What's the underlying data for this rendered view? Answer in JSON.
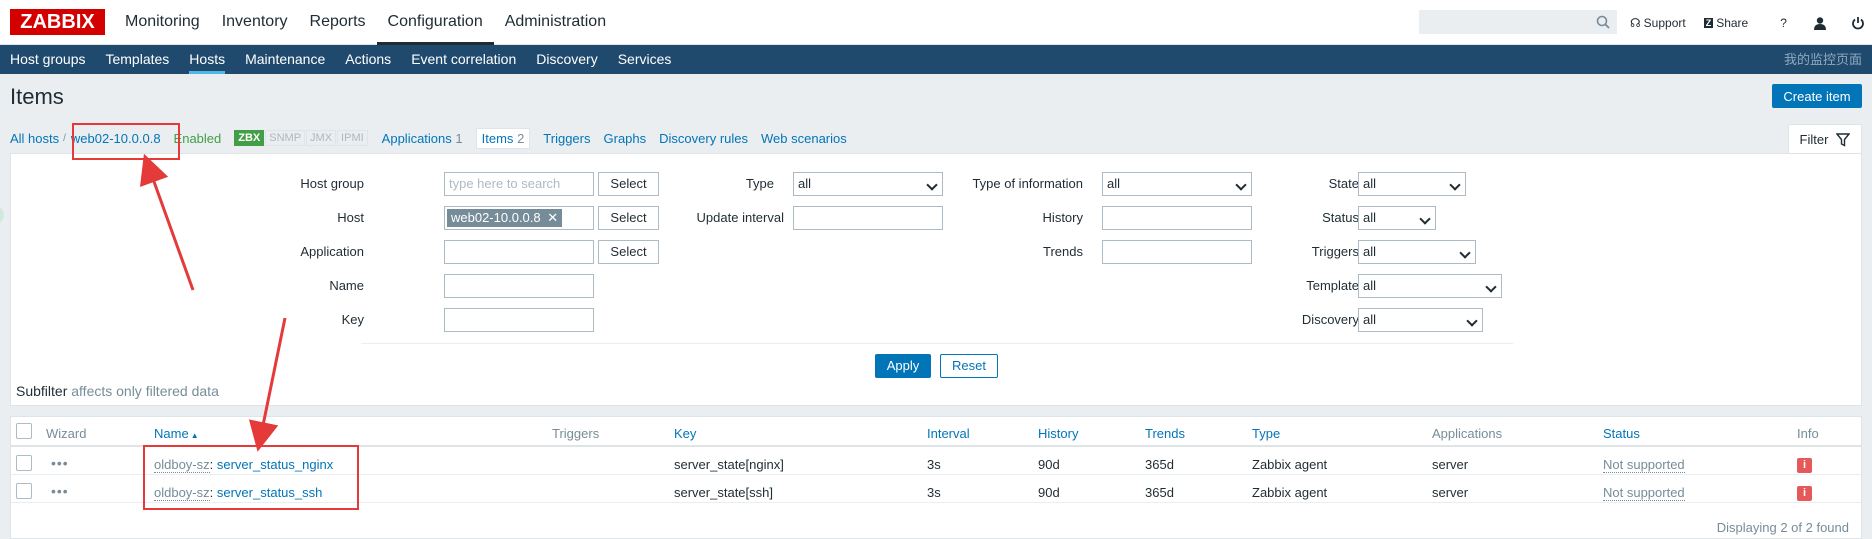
{
  "app": {
    "logo": "ZABBIX",
    "main_menu": [
      "Monitoring",
      "Inventory",
      "Reports",
      "Configuration",
      "Administration"
    ],
    "active_main": "Configuration",
    "search": {
      "placeholder": ""
    },
    "top_links": [
      {
        "icon": "headset-icon",
        "label": "Support"
      },
      {
        "icon": "share-icon",
        "label": "Share"
      },
      {
        "icon": "help-icon",
        "label": "?"
      },
      {
        "icon": "user-icon",
        "label": ""
      },
      {
        "icon": "power-icon",
        "label": ""
      }
    ]
  },
  "subnav": {
    "items": [
      "Host groups",
      "Templates",
      "Hosts",
      "Maintenance",
      "Actions",
      "Event correlation",
      "Discovery",
      "Services"
    ],
    "active": "Hosts",
    "right_text": "我的监控页面"
  },
  "page": {
    "title": "Items",
    "create_button": "Create item"
  },
  "host_nav": {
    "all_hosts": "All hosts",
    "separator": "/",
    "host": "web02-10.0.0.8",
    "status": "Enabled",
    "availability": [
      "ZBX",
      "SNMP",
      "JMX",
      "IPMI"
    ],
    "applications_label": "Applications",
    "applications_count": "1",
    "items_label": "Items",
    "items_count": "2",
    "triggers": "Triggers",
    "graphs": "Graphs",
    "discovery_rules": "Discovery rules",
    "web_scenarios": "Web scenarios",
    "filter_tab": "Filter"
  },
  "filter": {
    "host_group_label": "Host group",
    "host_group_placeholder": "type here to search",
    "host_label": "Host",
    "host_value": "web02-10.0.0.8",
    "application_label": "Application",
    "name_label": "Name",
    "key_label": "Key",
    "select_label": "Select",
    "type_label": "Type",
    "type_value": "all",
    "update_interval_label": "Update interval",
    "type_of_information_label": "Type of information",
    "type_of_information_value": "all",
    "history_label": "History",
    "trends_label": "Trends",
    "state_label": "State",
    "state_value": "all",
    "status_label": "Status",
    "status_value": "all",
    "triggers_label": "Triggers",
    "triggers_value": "all",
    "template_label": "Template",
    "template_value": "all",
    "discovery_label": "Discovery",
    "discovery_value": "all",
    "apply": "Apply",
    "reset": "Reset"
  },
  "subfilter": {
    "label": "Subfilter",
    "note": "affects only filtered data"
  },
  "table": {
    "headers": {
      "wizard": "Wizard",
      "name": "Name",
      "triggers": "Triggers",
      "key": "Key",
      "interval": "Interval",
      "history": "History",
      "trends": "Trends",
      "type": "Type",
      "applications": "Applications",
      "status": "Status",
      "info": "Info"
    },
    "sort_indicator": "▲",
    "rows": [
      {
        "host": "oldboy-sz",
        "name": "server_status_nginx",
        "key": "server_state[nginx]",
        "interval": "3s",
        "history": "90d",
        "trends": "365d",
        "type": "Zabbix agent",
        "applications": "server",
        "status": "Not supported",
        "info": "i"
      },
      {
        "host": "oldboy-sz",
        "name": "server_status_ssh",
        "key": "server_state[ssh]",
        "interval": "3s",
        "history": "90d",
        "trends": "365d",
        "type": "Zabbix agent",
        "applications": "server",
        "status": "Not supported",
        "info": "i"
      }
    ],
    "footer": "Displaying 2 of 2 found"
  },
  "colors": {
    "accent": "#0275b8",
    "subnav_bg": "#1f4a6e",
    "logo_red": "#d40000",
    "annotation_red": "#e43a3a",
    "enabled_green": "#429e47"
  }
}
